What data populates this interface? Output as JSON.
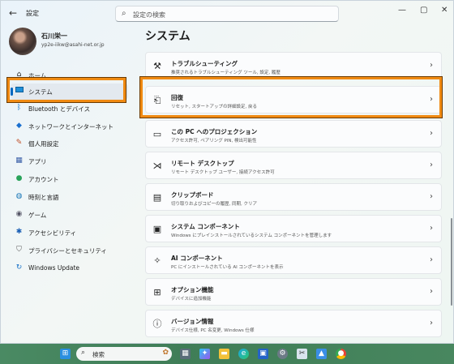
{
  "window": {
    "title": "設定",
    "back_icon": "back-arrow-icon",
    "controls": [
      "—",
      "▢",
      "✕"
    ]
  },
  "search": {
    "placeholder": "設定の検索"
  },
  "profile": {
    "name": "石川栄一",
    "email": "yp2e-iikw@asahi-net.or.jp"
  },
  "sidebar": {
    "items": [
      {
        "label": "ホーム",
        "icon": "home-icon"
      },
      {
        "label": "システム",
        "icon": "system-display-icon",
        "active": true
      },
      {
        "label": "Bluetooth とデバイス",
        "icon": "bluetooth-icon"
      },
      {
        "label": "ネットワークとインターネット",
        "icon": "wifi-icon"
      },
      {
        "label": "個人用設定",
        "icon": "brush-icon"
      },
      {
        "label": "アプリ",
        "icon": "apps-icon"
      },
      {
        "label": "アカウント",
        "icon": "account-icon"
      },
      {
        "label": "時刻と言語",
        "icon": "globe-clock-icon"
      },
      {
        "label": "ゲーム",
        "icon": "gamepad-icon"
      },
      {
        "label": "アクセシビリティ",
        "icon": "accessibility-icon"
      },
      {
        "label": "プライバシーとセキュリティ",
        "icon": "shield-icon"
      },
      {
        "label": "Windows Update",
        "icon": "update-icon"
      }
    ]
  },
  "main": {
    "title": "システム",
    "cards": [
      {
        "title": "トラブルシューティング",
        "desc": "推奨されるトラブルシューティング ツール, 設定, 履歴",
        "icon": "wrench-icon"
      },
      {
        "title": "回復",
        "desc": "リセット, スタートアップの詳細設定, 戻る",
        "icon": "recovery-icon"
      },
      {
        "title": "この PC へのプロジェクション",
        "desc": "アクセス許可, ペアリング PIN, 検出可能性",
        "icon": "projection-icon"
      },
      {
        "title": "リモート デスクトップ",
        "desc": "リモート デスクトップ ユーザー, 接続アクセス許可",
        "icon": "remote-desktop-icon"
      },
      {
        "title": "クリップボード",
        "desc": "切り取りおよびコピーの履歴, 同期, クリア",
        "icon": "clipboard-icon"
      },
      {
        "title": "システム コンポーネント",
        "desc": "Windows にプレインストールされているシステム コンポーネントを管理します",
        "icon": "system-components-icon"
      },
      {
        "title": "AI コンポーネント",
        "desc": "PC にインストールされている AI コンポーネントを表示",
        "icon": "ai-sparkle-icon"
      },
      {
        "title": "オプション機能",
        "desc": "デバイスに追加機能",
        "icon": "optional-features-icon"
      },
      {
        "title": "バージョン情報",
        "desc": "デバイス仕様, PC 名変更, Windows 仕様",
        "icon": "info-icon"
      }
    ]
  },
  "taskbar": {
    "search_label": "検索",
    "icons": [
      "windows-start-icon",
      "widgets-icon",
      "copilot-icon",
      "file-explorer-icon",
      "edge-icon",
      "store-icon",
      "settings-icon",
      "snipping-tool-icon",
      "photos-icon",
      "chrome-icon"
    ]
  }
}
